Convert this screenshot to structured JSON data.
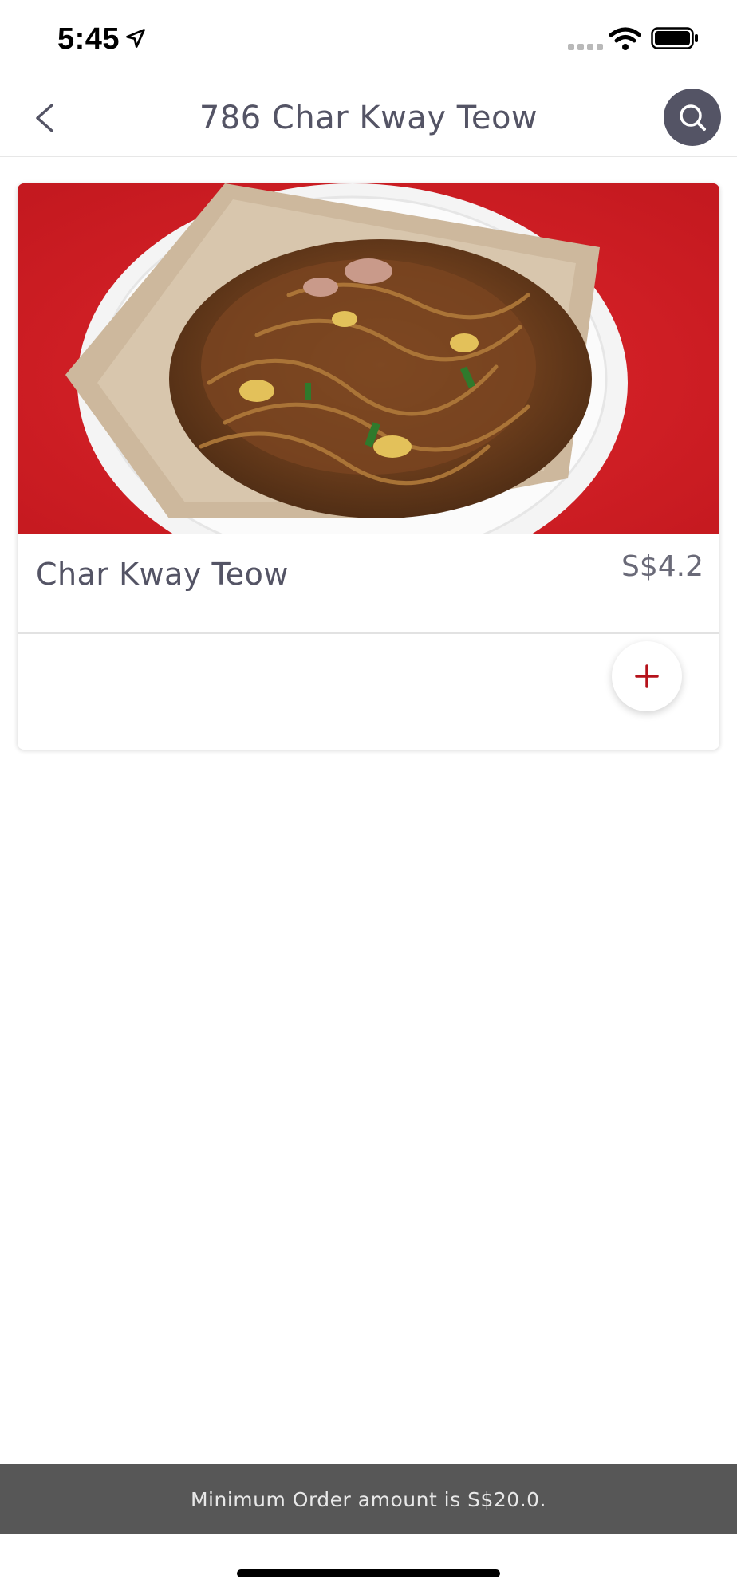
{
  "status_bar": {
    "time": "5:45"
  },
  "header": {
    "title": "786 Char Kway Teow"
  },
  "menu": {
    "items": [
      {
        "name": "Char Kway Teow",
        "price": "S$4.2",
        "image": "char-kway-teow-photo"
      }
    ]
  },
  "banner": {
    "text": "Minimum Order amount is S$20.0."
  },
  "colors": {
    "header_icon_bg": "#545465",
    "add_icon": "#b5121b",
    "banner_bg": "#575757",
    "image_bg": "#d61f26"
  }
}
